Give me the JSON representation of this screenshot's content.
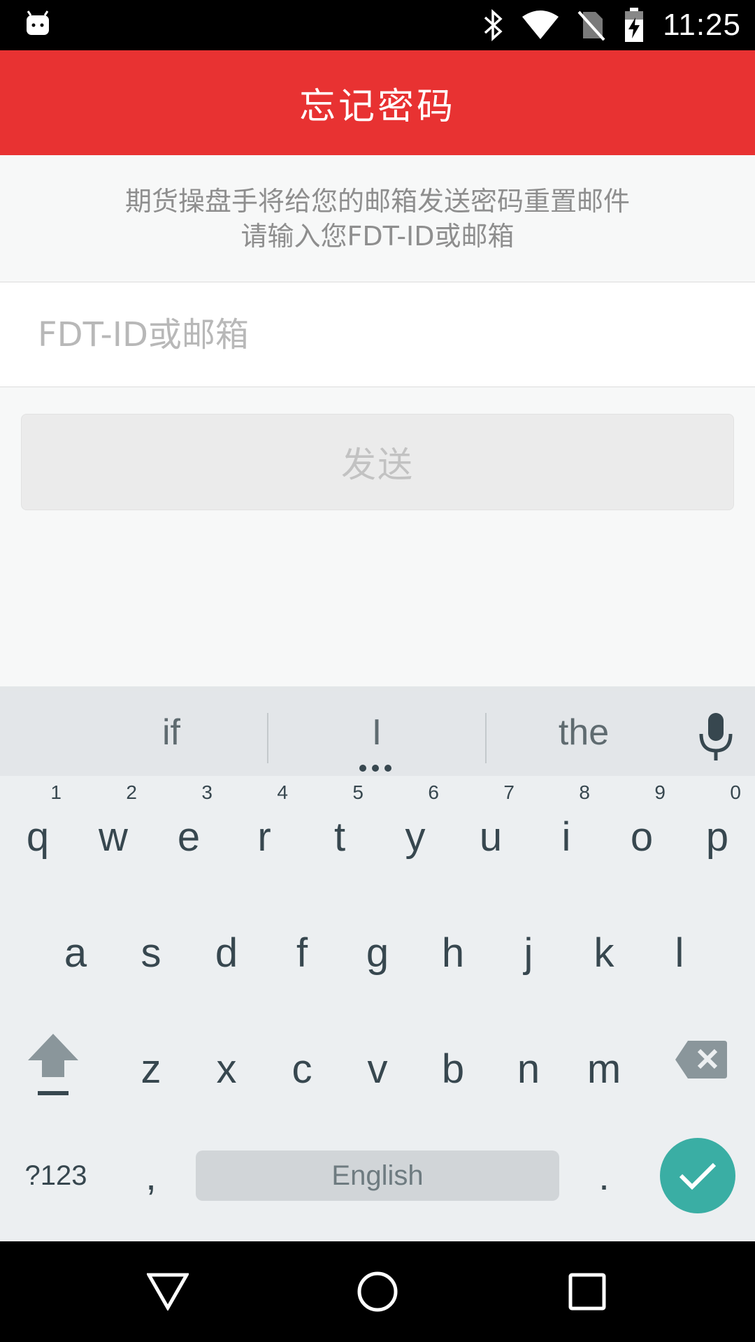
{
  "status_bar": {
    "time": "11:25",
    "icons": [
      "android-notification-icon",
      "bluetooth-icon",
      "wifi-icon",
      "no-sim-icon",
      "battery-charging-icon"
    ]
  },
  "app_bar": {
    "title": "忘记密码"
  },
  "info": {
    "line1": "期货操盘手将给您的邮箱发送密码重置邮件",
    "line2": "请输入您FDT-ID或邮箱"
  },
  "input": {
    "placeholder": "FDT-ID或邮箱",
    "value": ""
  },
  "send_button": {
    "label": "发送"
  },
  "keyboard": {
    "suggestions": [
      "if",
      "I",
      "the"
    ],
    "row1": [
      {
        "k": "q",
        "h": "1"
      },
      {
        "k": "w",
        "h": "2"
      },
      {
        "k": "e",
        "h": "3"
      },
      {
        "k": "r",
        "h": "4"
      },
      {
        "k": "t",
        "h": "5"
      },
      {
        "k": "y",
        "h": "6"
      },
      {
        "k": "u",
        "h": "7"
      },
      {
        "k": "i",
        "h": "8"
      },
      {
        "k": "o",
        "h": "9"
      },
      {
        "k": "p",
        "h": "0"
      }
    ],
    "row2": [
      "a",
      "s",
      "d",
      "f",
      "g",
      "h",
      "j",
      "k",
      "l"
    ],
    "row3": [
      "z",
      "x",
      "c",
      "v",
      "b",
      "n",
      "m"
    ],
    "symbols_label": "?123",
    "comma": ",",
    "space_label": "English",
    "period": "."
  },
  "colors": {
    "accent": "#e83232",
    "enter_key": "#3aaea4",
    "key_text": "#37474f"
  }
}
